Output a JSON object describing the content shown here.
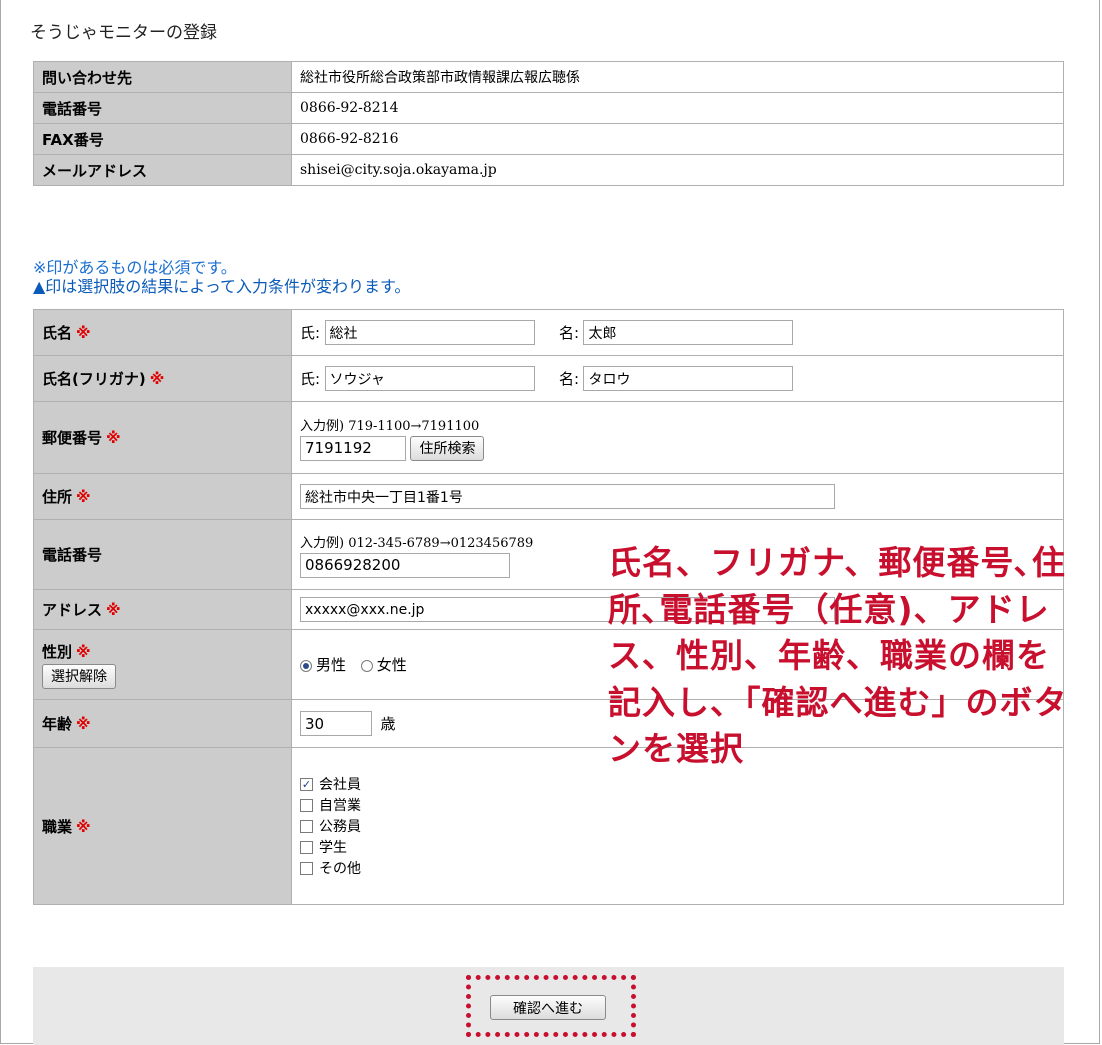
{
  "page_title": "そうじゃモニターの登録",
  "contact": [
    {
      "label": "問い合わせ先",
      "value": "総社市役所総合政策部市政情報課広報広聴係"
    },
    {
      "label": "電話番号",
      "value": "0866-92-8214"
    },
    {
      "label": "FAX番号",
      "value": "0866-92-8216"
    },
    {
      "label": "メールアドレス",
      "value": "shisei@city.soja.okayama.jp"
    }
  ],
  "notes": {
    "required": "※印があるものは必須です。",
    "conditional": "▲印は選択肢の結果によって入力条件が変わります。"
  },
  "required_mark": "※",
  "form": {
    "name": {
      "label": "氏名",
      "sei_label": "氏:",
      "sei_value": "総社",
      "mei_label": "名:",
      "mei_value": "太郎"
    },
    "kana": {
      "label": "氏名(フリガナ)",
      "sei_label": "氏:",
      "sei_value": "ソウジャ",
      "mei_label": "名:",
      "mei_value": "タロウ"
    },
    "postal": {
      "label": "郵便番号",
      "example": "入力例) 719-1100→7191100",
      "value": "7191192",
      "search_button": "住所検索"
    },
    "address": {
      "label": "住所",
      "value": "総社市中央一丁目1番1号"
    },
    "phone": {
      "label": "電話番号",
      "example": "入力例) 012-345-6789→0123456789",
      "value": "0866928200"
    },
    "email": {
      "label": "アドレス",
      "value": "xxxxx@xxx.ne.jp"
    },
    "gender": {
      "label": "性別",
      "clear_button": "選択解除",
      "options": [
        "男性",
        "女性"
      ],
      "selected": "男性"
    },
    "age": {
      "label": "年齢",
      "value": "30",
      "unit": "歳"
    },
    "occupation": {
      "label": "職業",
      "options": [
        "会社員",
        "自営業",
        "公務員",
        "学生",
        "その他"
      ],
      "checked": [
        "会社員"
      ]
    }
  },
  "confirm_button": "確認へ進む",
  "annotation": "氏名、フリガナ、郵便番号､住所､電話番号（任意)、アドレス、性別、年齢、職業の欄を記入し、「確認へ進む」のボタンを選択",
  "colors": {
    "annotation": "#c8102e",
    "required": "#e00000",
    "notes": "#1a6fd0",
    "header_cell": "#cccccc"
  }
}
